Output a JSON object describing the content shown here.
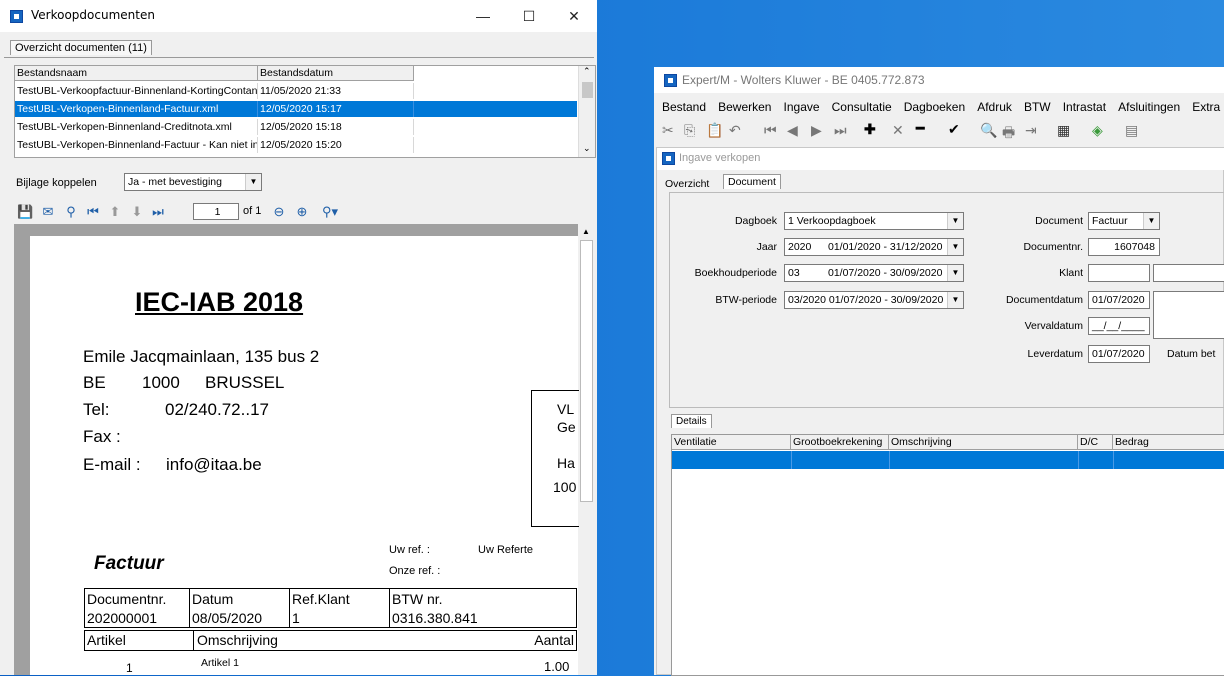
{
  "left_window": {
    "title": "Verkoopdocumenten",
    "minimize": "—",
    "maximize": "☐",
    "close": "✕",
    "tab_label": "Overzicht documenten (11)",
    "columns": [
      "Bestandsnaam",
      "Bestandsdatum"
    ],
    "rows": [
      {
        "name": "TestUBL-Verkoopfactuur-Binnenland-KortingContant",
        "date": "11/05/2020 21:33"
      },
      {
        "name": "TestUBL-Verkopen-Binnenland-Factuur.xml",
        "date": "12/05/2020 15:17"
      },
      {
        "name": "TestUBL-Verkopen-Binnenland-Creditnota.xml",
        "date": "12/05/2020 15:18"
      },
      {
        "name": "TestUBL-Verkopen-Binnenland-Factuur - Kan niet in",
        "date": "12/05/2020 15:20"
      }
    ],
    "bijlage_label": "Bijlage koppelen",
    "bijlage_value": "Ja - met bevestiging",
    "page_input": "1",
    "page_of": "of 1",
    "document": {
      "company": "IEC-IAB 2018",
      "address": "Emile Jacqmainlaan, 135 bus 2",
      "country": "BE",
      "postcode": "1000",
      "city": "BRUSSEL",
      "tel_label": "Tel:",
      "tel_value": "02/240.72..17",
      "fax_label": "Fax :",
      "email_label": "E-mail :",
      "email_value": "info@itaa.be",
      "box_lines": [
        "VL",
        "Ge",
        "Ha",
        "100"
      ],
      "uw_ref_label": "Uw ref. :",
      "uw_ref_value": "Uw Referte",
      "onze_ref_label": "Onze ref. :",
      "factuur_title": "Factuur",
      "table_headers": [
        "Documentnr.",
        "Datum",
        "Ref.Klant",
        "BTW nr."
      ],
      "table_values": [
        "202000001",
        "08/05/2020",
        "1",
        "0316.380.841"
      ],
      "line_headers": [
        "Artikel",
        "Omschrijving",
        "Aantal"
      ],
      "line_item": {
        "nr": "1",
        "desc": "Artikel 1",
        "qty": "1.00"
      }
    }
  },
  "right_window": {
    "title": "Expert/M - Wolters Kluwer - BE 0405.772.873",
    "menu": [
      "Bestand",
      "Bewerken",
      "Ingave",
      "Consultatie",
      "Dagboeken",
      "Afdruk",
      "BTW",
      "Intrastat",
      "Afsluitingen",
      "Extra"
    ],
    "sub_title": "Ingave verkopen",
    "tabs": [
      "Overzicht",
      "Document"
    ],
    "fields": {
      "dagboek_label": "Dagboek",
      "dagboek_value": "1 Verkoopdagboek",
      "jaar_label": "Jaar",
      "jaar_value": "2020",
      "jaar_range": "01/01/2020 - 31/12/2020",
      "periode_label": "Boekhoudperiode",
      "periode_value": "03",
      "periode_range": "01/07/2020 - 30/09/2020",
      "btw_label": "BTW-periode",
      "btw_value": "03/2020 01/07/2020 - 30/09/2020",
      "document_label": "Document",
      "document_value": "Factuur",
      "docnr_label": "Documentnr.",
      "docnr_value": "1607048",
      "klant_label": "Klant",
      "docdatum_label": "Documentdatum",
      "docdatum_value": "01/07/2020",
      "verval_label": "Vervaldatum",
      "verval_value": "__/__/____",
      "lever_label": "Leverdatum",
      "lever_value": "01/07/2020",
      "datum_bet_label": "Datum bet"
    },
    "details_tab": "Details",
    "detail_columns": [
      "Ventilatie",
      "Grootboekrekening",
      "Omschrijving",
      "D/C",
      "Bedrag"
    ]
  }
}
